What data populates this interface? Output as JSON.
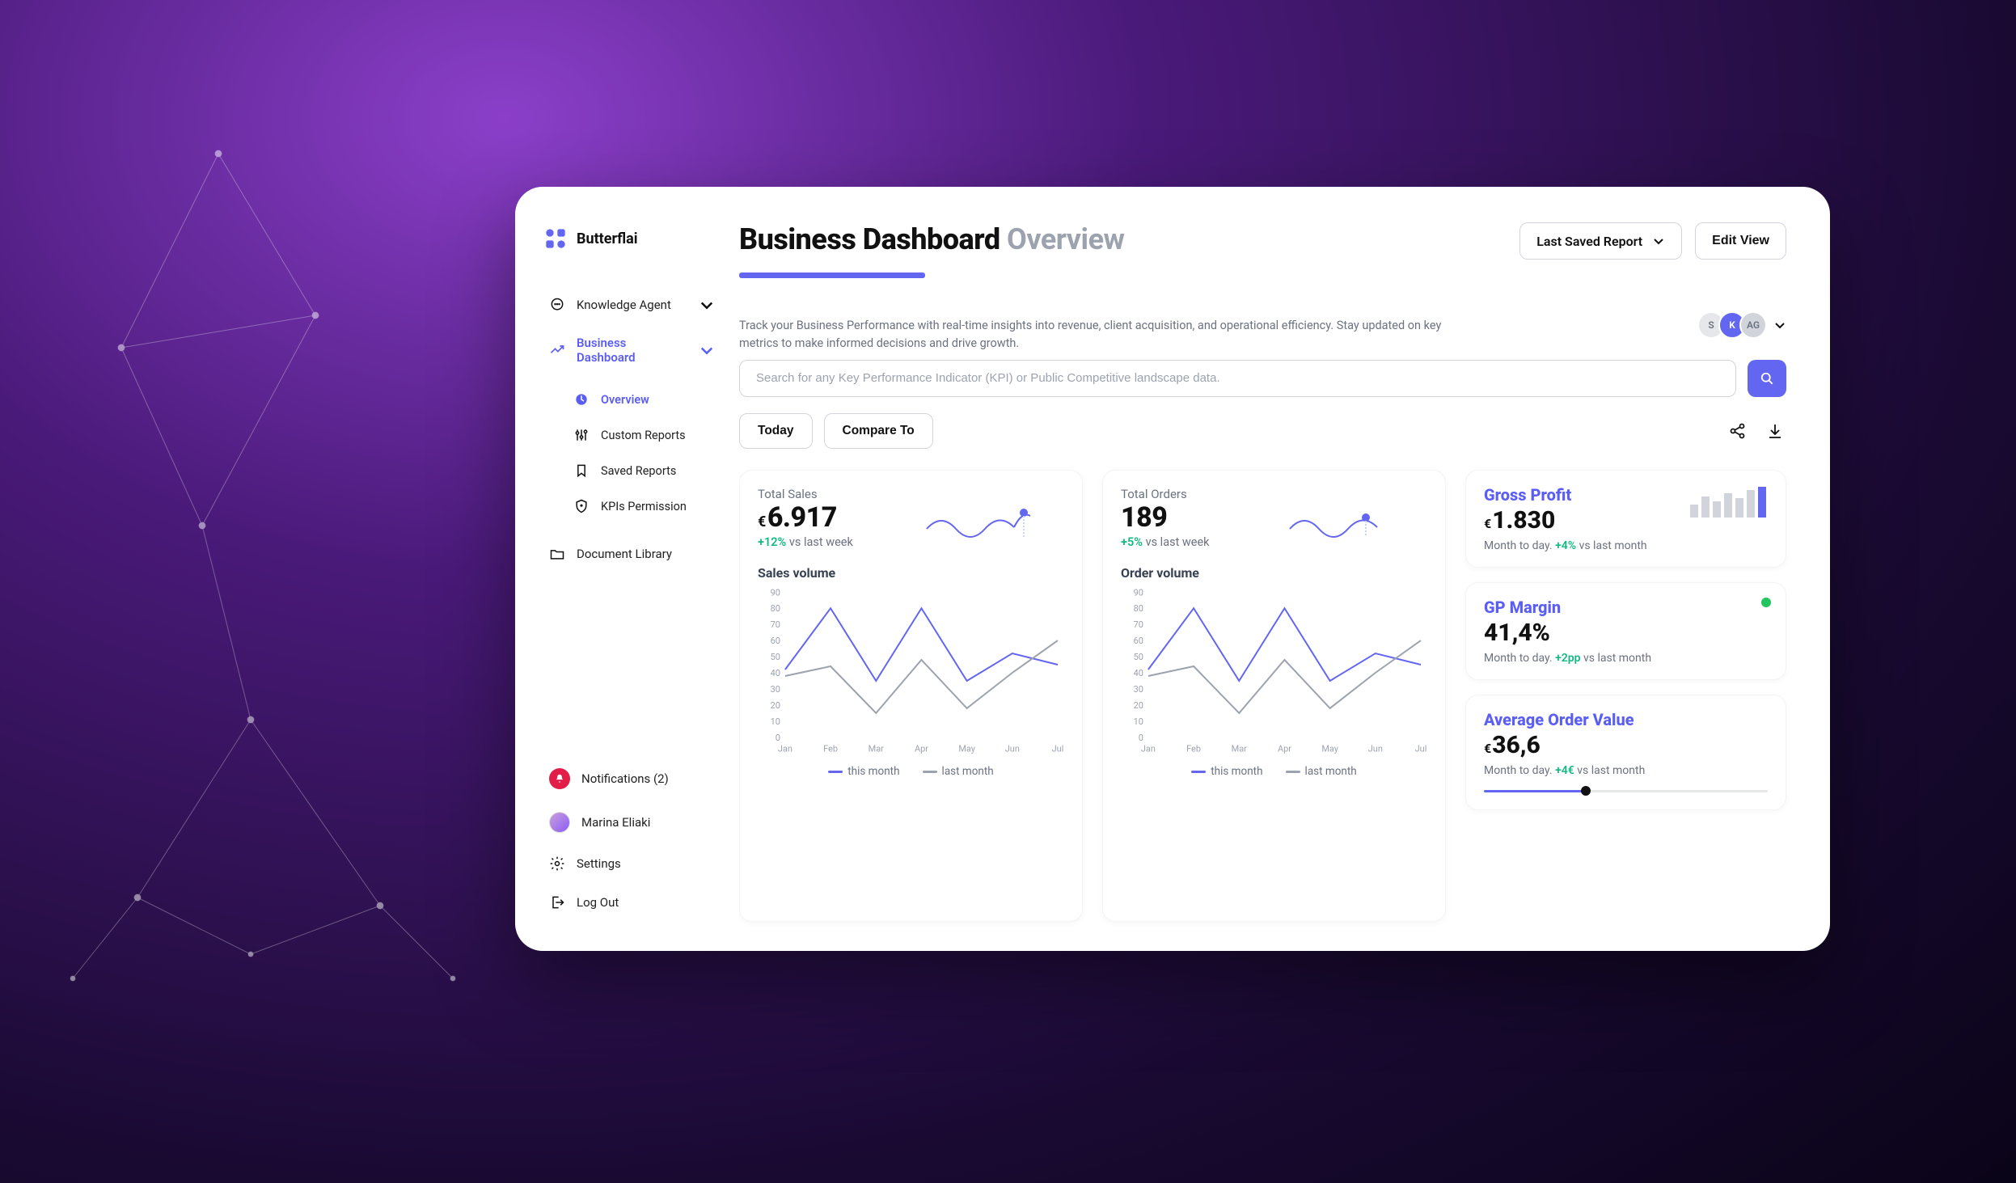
{
  "brand": {
    "name": "Butterflai"
  },
  "sidebar": {
    "items": [
      {
        "label": "Knowledge Agent",
        "icon": "chat-icon",
        "expandable": true
      },
      {
        "label": "Business Dashboard",
        "icon": "trend-icon",
        "expandable": true,
        "active": true
      },
      {
        "label": "Document Library",
        "icon": "folder-icon"
      }
    ],
    "dashboard_sub": [
      {
        "label": "Overview",
        "icon": "clock-icon",
        "active": true
      },
      {
        "label": "Custom Reports",
        "icon": "sliders-icon"
      },
      {
        "label": "Saved Reports",
        "icon": "bookmark-icon"
      },
      {
        "label": "KPIs Permission",
        "icon": "shield-icon"
      }
    ],
    "bottom": {
      "notifications": "Notifications (2)",
      "user_name": "Marina Eliaki",
      "settings": "Settings",
      "logout": "Log Out"
    }
  },
  "header": {
    "title": "Business Dashboard",
    "subtitle": "Overview",
    "description": "Track your Business Performance with real-time insights into revenue, client acquisition, and operational efficiency. Stay updated on key metrics to make informed decisions and drive growth.",
    "select_label": "Last Saved Report",
    "edit_btn": "Edit View"
  },
  "avatars": [
    "S",
    "K",
    "AG"
  ],
  "search": {
    "placeholder": "Search for any Key Performance Indicator (KPI) or Public Competitive landscape data."
  },
  "filters": {
    "today": "Today",
    "compare": "Compare To"
  },
  "metrics": {
    "sales": {
      "label": "Total Sales",
      "currency": "€",
      "value": "6.917",
      "delta": "+12%",
      "delta_suffix": " vs  last week"
    },
    "orders": {
      "label": "Total Orders",
      "value": "189",
      "delta": "+5%",
      "delta_suffix": " vs  last week"
    }
  },
  "kpis": {
    "gross_profit": {
      "title": "Gross Profit",
      "currency": "€",
      "value": "1.830",
      "sub_prefix": "Month to day. ",
      "delta": "+4%",
      "sub_suffix": " vs last month"
    },
    "gp_margin": {
      "title": "GP Margin",
      "value": "41,4%",
      "sub_prefix": "Month to day. ",
      "delta": "+2pp",
      "sub_suffix": " vs last month"
    },
    "aov": {
      "title": "Average Order Value",
      "currency": "€",
      "value": "36,6",
      "sub_prefix": "Month to day. ",
      "delta": "+4€",
      "sub_suffix": " vs last month",
      "slider_pct": 36
    }
  },
  "charts": {
    "sales_volume": {
      "title": "Sales volume",
      "legend_this": "this month",
      "legend_last": "last month"
    },
    "order_volume": {
      "title": "Order volume",
      "legend_this": "this month",
      "legend_last": "last month"
    }
  },
  "chart_data": [
    {
      "type": "line",
      "title": "Sales volume",
      "xlabel": "",
      "ylabel": "",
      "categories": [
        "Jan",
        "Feb",
        "Mar",
        "Apr",
        "May",
        "Jun",
        "Jul"
      ],
      "ylim": [
        0,
        90
      ],
      "y_ticks": [
        0,
        10,
        20,
        30,
        40,
        50,
        60,
        70,
        80,
        90
      ],
      "series": [
        {
          "name": "this month",
          "color": "#6366F1",
          "values": [
            42,
            80,
            35,
            80,
            35,
            52,
            45
          ]
        },
        {
          "name": "last month",
          "color": "#9CA3AF",
          "values": [
            38,
            44,
            15,
            48,
            18,
            40,
            60
          ]
        }
      ]
    },
    {
      "type": "line",
      "title": "Order volume",
      "xlabel": "",
      "ylabel": "",
      "categories": [
        "Jan",
        "Feb",
        "Mar",
        "Apr",
        "May",
        "Jun",
        "Jul"
      ],
      "ylim": [
        0,
        90
      ],
      "y_ticks": [
        0,
        10,
        20,
        30,
        40,
        50,
        60,
        70,
        80,
        90
      ],
      "series": [
        {
          "name": "this month",
          "color": "#6366F1",
          "values": [
            42,
            80,
            35,
            80,
            35,
            52,
            45
          ]
        },
        {
          "name": "last month",
          "color": "#9CA3AF",
          "values": [
            38,
            44,
            15,
            48,
            18,
            40,
            60
          ]
        }
      ]
    }
  ],
  "colors": {
    "accent": "#6366F1",
    "accent2": "#5B5EF4",
    "positive": "#10B981",
    "muted": "#9CA3AF"
  }
}
